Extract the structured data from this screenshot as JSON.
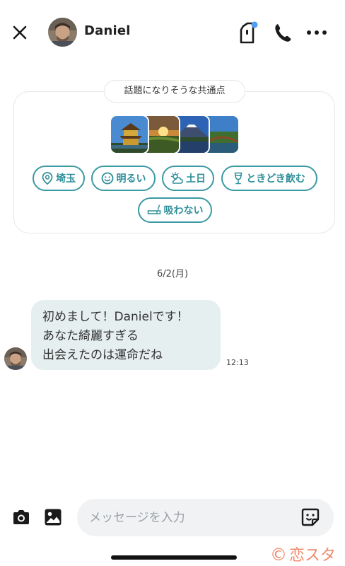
{
  "header": {
    "name": "Daniel",
    "icons": [
      "close-icon",
      "avatar",
      "notification-icon",
      "phone-icon",
      "more-icon"
    ],
    "notification_dot_color": "#4d9cf5"
  },
  "common_points": {
    "title": "話題になりそうな共通点",
    "photos": [
      "golden-pavilion",
      "sunset-field",
      "mount-fuji",
      "lake-bridge"
    ],
    "tags": [
      {
        "label": "埼玉",
        "icon": "location-icon"
      },
      {
        "label": "明るい",
        "icon": "smile-icon"
      },
      {
        "label": "土日",
        "icon": "sun-cloud-icon"
      },
      {
        "label": "ときどき飲む",
        "icon": "glass-icon"
      },
      {
        "label": "吸わない",
        "icon": "no-smoking-icon"
      }
    ],
    "accent_color": "#3b9aa3"
  },
  "chat": {
    "date": "6/2(月)",
    "messages": [
      {
        "sender": "Daniel",
        "lines": [
          "初めまして！Danielです！",
          "あなた綺麗すぎる",
          "出会えたのは運命だね"
        ],
        "time": "12:13"
      }
    ]
  },
  "composer": {
    "placeholder": "メッセージを入力",
    "icons": [
      "camera-icon",
      "image-icon",
      "sticker-icon"
    ]
  },
  "watermark": {
    "text": "恋スタ",
    "symbol": "©",
    "color": "#f08a6b"
  }
}
